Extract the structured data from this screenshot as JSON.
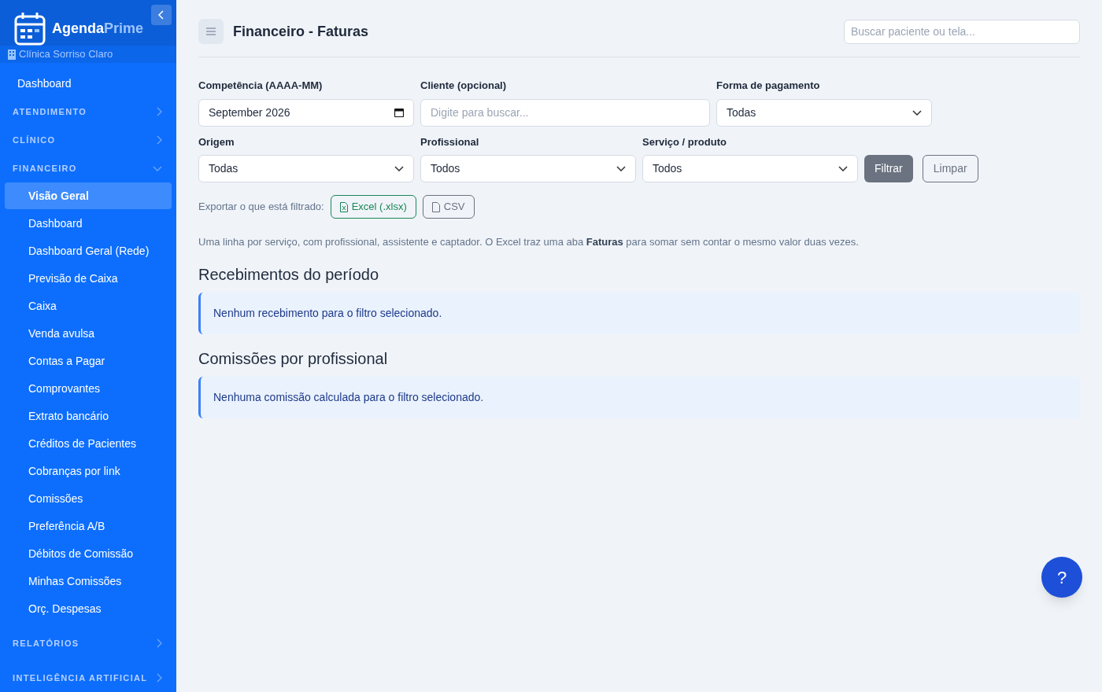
{
  "brand": {
    "name_bold": "Agenda",
    "name_accent": "Prime"
  },
  "clinic": "Clínica Sorriso Claro",
  "sidebar": {
    "items": [
      {
        "kind": "link",
        "label": "Dashboard",
        "selected": false
      },
      {
        "kind": "section",
        "label": "ATENDIMENTO",
        "expanded": false
      },
      {
        "kind": "section",
        "label": "CLÍNICO",
        "expanded": false
      },
      {
        "kind": "section",
        "label": "FINANCEIRO",
        "expanded": true,
        "children": [
          {
            "label": "Visão Geral",
            "selected": true
          },
          {
            "label": "Dashboard",
            "selected": false
          },
          {
            "label": "Dashboard Geral (Rede)",
            "selected": false
          },
          {
            "label": "Previsão de Caixa",
            "selected": false
          },
          {
            "label": "Caixa",
            "selected": false
          },
          {
            "label": "Venda avulsa",
            "selected": false
          },
          {
            "label": "Contas a Pagar",
            "selected": false
          },
          {
            "label": "Comprovantes",
            "selected": false
          },
          {
            "label": "Extrato bancário",
            "selected": false
          },
          {
            "label": "Créditos de Pacientes",
            "selected": false
          },
          {
            "label": "Cobranças por link",
            "selected": false
          },
          {
            "label": "Comissões",
            "selected": false
          },
          {
            "label": "Preferência A/B",
            "selected": false
          },
          {
            "label": "Débitos de Comissão",
            "selected": false
          },
          {
            "label": "Minhas Comissões",
            "selected": false
          },
          {
            "label": "Orç. Despesas",
            "selected": false
          }
        ]
      },
      {
        "kind": "section",
        "label": "RELATÓRIOS",
        "expanded": false
      },
      {
        "kind": "section",
        "label": "INTELIGÊNCIA ARTIFICIAL",
        "expanded": false
      }
    ]
  },
  "header": {
    "title": "Financeiro - Faturas",
    "search": {
      "placeholder": "Buscar paciente ou tela..."
    }
  },
  "filters": {
    "row_1": [
      {
        "kind": "date",
        "label": "Competência (AAAA-MM)",
        "value": "September 2026"
      },
      {
        "kind": "text",
        "label": "Cliente (opcional)",
        "placeholder": "Digite para buscar..."
      },
      {
        "kind": "select",
        "label": "Forma de pagamento",
        "value": "Todas"
      }
    ],
    "row_2": [
      {
        "kind": "select",
        "label": "Origem",
        "value": "Todas"
      },
      {
        "kind": "select",
        "label": "Profissional",
        "value": "Todos"
      },
      {
        "kind": "select",
        "label": "Serviço / produto",
        "value": "Todos"
      }
    ],
    "buttons": [
      "Filtrar",
      "Limpar"
    ]
  },
  "export": {
    "label": "Exportar o que está filtrado:",
    "buttons": [
      {
        "kind": "excel",
        "label": "Excel (.xlsx)"
      },
      {
        "kind": "csv",
        "label": "CSV"
      }
    ]
  },
  "note": "Uma linha por serviço, com profissional, assistente e captador. O Excel traz uma aba **Faturas** para somar sem contar o mesmo valor duas vezes.",
  "sections": [
    {
      "title": "Recebimentos do período",
      "message": "Nenhum recebimento para o filtro selecionado."
    },
    {
      "title": "Comissões por profissional",
      "message": "Nenhuma comissão calculada para o filtro selecionado."
    }
  ],
  "help_button": "?"
}
